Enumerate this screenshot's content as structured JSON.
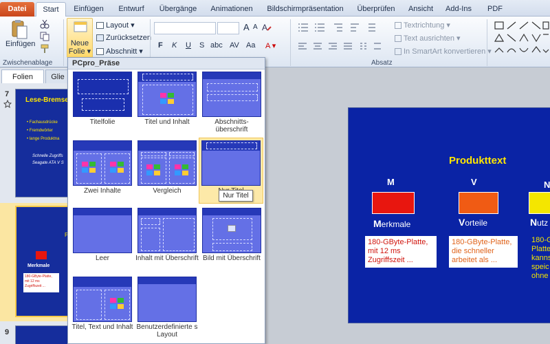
{
  "tabs": [
    "Datei",
    "Start",
    "Einfügen",
    "Entwurf",
    "Übergänge",
    "Animationen",
    "Bildschirmpräsentation",
    "Überprüfen",
    "Ansicht",
    "Add-Ins",
    "PDF"
  ],
  "ribbon": {
    "einfuegen": "Einfügen",
    "zwischenablage": "Zwischenablage",
    "neue_folie_1": "Neue",
    "neue_folie_2": "Folie",
    "layout": "Layout",
    "zuruecksetzen": "Zurücksetzen",
    "abschnitt": "Abschnitt",
    "textrichtung": "Textrichtung",
    "text_ausrichten": "Text ausrichten",
    "smartart": "In SmartArt konvertieren",
    "absatz": "Absatz",
    "bold": "F",
    "italic": "K",
    "underline": "U",
    "strike": "S",
    "shadow": "abc",
    "spacing": "AV",
    "case": "Aa",
    "grow": "A",
    "shrink": "A"
  },
  "left_pane": {
    "tab_folien": "Folien",
    "tab_gliederung": "Glie",
    "slide7": {
      "num": "7",
      "title": "Lese-Bremse",
      "bullets": [
        "Fachausdrücke",
        "Fremdwörter",
        "lange Produktna"
      ],
      "footer1": "Schnelle Zugriffs",
      "footer2": "Seagate ATA V S"
    },
    "slide8": {
      "num": "8",
      "label": "Merkmale",
      "partial": "P",
      "text1": "180-GByte-Platte,",
      "text2": "mit 12 ms",
      "text3": "Zugriffszeit ..."
    },
    "slide9": {
      "num": "9"
    }
  },
  "gallery": {
    "title": "PCpro_Präse",
    "layouts": [
      {
        "name": "Titelfolie"
      },
      {
        "name": "Titel und Inhalt"
      },
      {
        "name": "Abschnitts-überschrift"
      },
      {
        "name": "Zwei Inhalte"
      },
      {
        "name": "Vergleich"
      },
      {
        "name": "Nur Titel"
      },
      {
        "name": "Leer"
      },
      {
        "name": "Inhalt mit Überschrift"
      },
      {
        "name": "Bild mit Überschrift"
      },
      {
        "name": "Titel, Text und Inhalt"
      },
      {
        "name": "Benutzerdefinierte s Layout"
      }
    ],
    "tooltip": "Nur Titel"
  },
  "slide": {
    "title": "Produkttext",
    "columns": [
      {
        "letter": "M",
        "color": "#e8160f",
        "label_first": "M",
        "label_rest": "erkmale",
        "text": [
          "180-GByte-Platte,",
          "mit 12 ms",
          "Zugriffszeit ..."
        ],
        "text_color": "#d0140c"
      },
      {
        "letter": "V",
        "color": "#f05b14",
        "label_first": "V",
        "label_rest": "orteile",
        "text": [
          "180-GByte-Platte,",
          "die schneller",
          "arbeitet als ..."
        ],
        "text_color": "#e0631a"
      },
      {
        "letter": "N",
        "color": "#f4e600",
        "label_first": "N",
        "label_rest": "utz",
        "text": [
          "180-G",
          "Platte",
          "kanns",
          "speic",
          "ohne"
        ],
        "text_color": "#f2e400"
      }
    ]
  },
  "colors": {
    "file_tab": "#c9461c",
    "slide_bg": "#0a23a5",
    "slide_title": "#ffe600",
    "layout_thumb": "#6470e6"
  }
}
